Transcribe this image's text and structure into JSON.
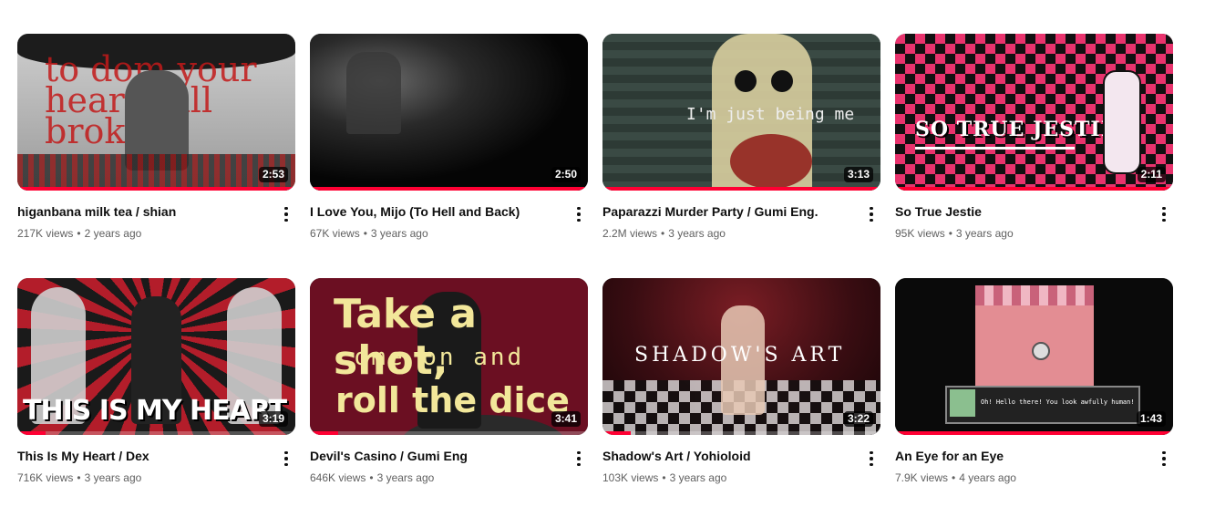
{
  "videos": [
    {
      "title": "higanbana milk tea / shian",
      "views": "217K views",
      "age": "2 years ago",
      "duration": "2:53",
      "progress_pct": 100,
      "thumb_icon": "anime-girl-drinking-thumbnail"
    },
    {
      "title": "I Love You, Mijo (To Hell and Back)",
      "views": "67K views",
      "age": "3 years ago",
      "duration": "2:50",
      "progress_pct": 100,
      "thumb_icon": "dark-room-thumbnail"
    },
    {
      "title": "Paparazzi Murder Party / Gumi Eng.",
      "views": "2.2M views",
      "age": "3 years ago",
      "duration": "3:13",
      "progress_pct": 100,
      "thumb_icon": "bloody-character-thumbnail"
    },
    {
      "title": "So True Jestie",
      "views": "95K views",
      "age": "3 years ago",
      "duration": "2:11",
      "progress_pct": 100,
      "thumb_icon": "jester-checkerboard-thumbnail"
    },
    {
      "title": "This Is My Heart / Dex",
      "views": "716K views",
      "age": "3 years ago",
      "duration": "3:19",
      "progress_pct": 10,
      "thumb_icon": "statues-thumbnail"
    },
    {
      "title": "Devil's Casino / Gumi Eng",
      "views": "646K views",
      "age": "3 years ago",
      "duration": "3:41",
      "progress_pct": 10,
      "thumb_icon": "casino-text-thumbnail"
    },
    {
      "title": "Shadow's Art / Yohioloid",
      "views": "103K views",
      "age": "3 years ago",
      "duration": "3:22",
      "progress_pct": 10,
      "thumb_icon": "checkered-floor-thumbnail"
    },
    {
      "title": "An Eye for an Eye",
      "views": "7.9K views",
      "age": "4 years ago",
      "duration": "1:43",
      "progress_pct": 100,
      "thumb_icon": "pixel-game-thumbnail"
    }
  ],
  "thumb_text": {
    "v1": "to dom your heart will broken",
    "v3": "I'm just being me",
    "v4": "SO TRUE JESTIE",
    "v5": "THIS IS MY HEART",
    "v6_line1": "Take a shot,",
    "v6_line2": "come on and",
    "v6_line3": "roll the dice",
    "v7": "SHADOW'S ART",
    "v8": "Oh! Hello there! You look awfully human!"
  },
  "colors": {
    "accent": "#ff0033",
    "title": "#0f0f0f",
    "meta": "#606060"
  }
}
